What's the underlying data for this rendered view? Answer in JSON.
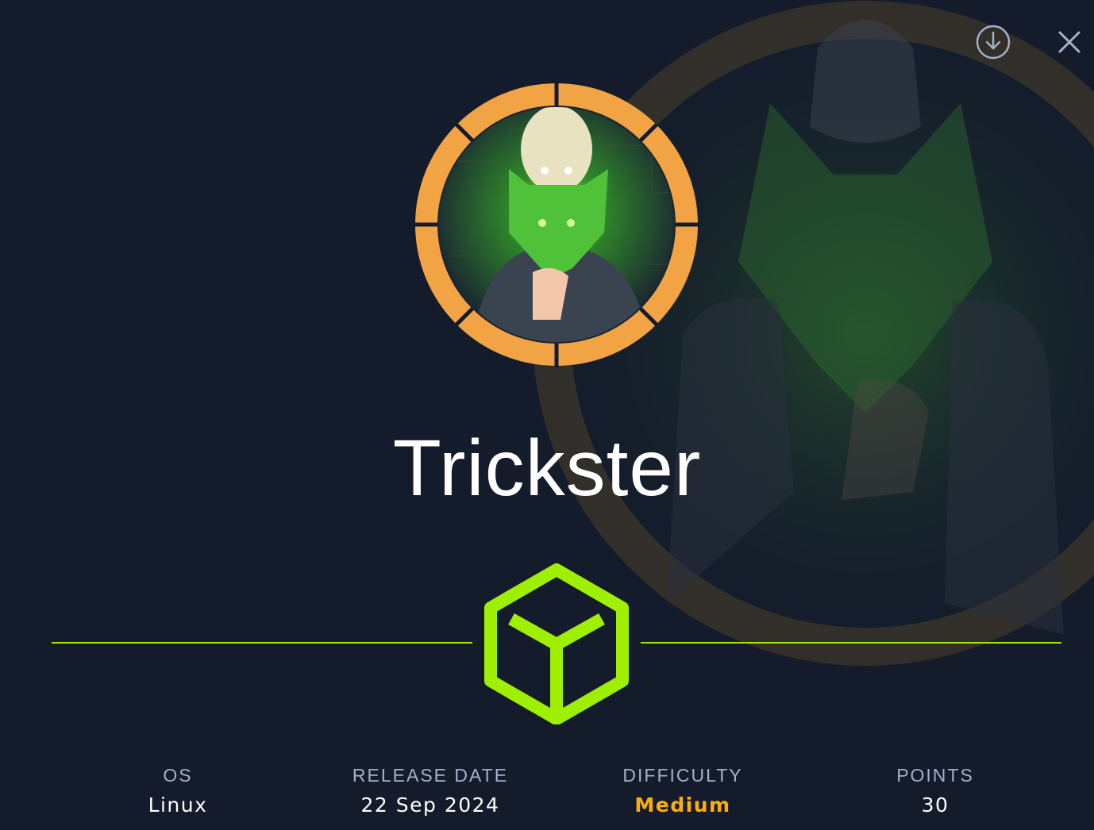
{
  "machine": {
    "name": "Trickster"
  },
  "stats": {
    "os": {
      "label": "OS",
      "value": "Linux"
    },
    "release_date": {
      "label": "RELEASE DATE",
      "value": "22 Sep 2024"
    },
    "difficulty": {
      "label": "DIFFICULTY",
      "value": "Medium"
    },
    "points": {
      "label": "POINTS",
      "value": "30"
    }
  },
  "controls": {
    "download_icon": "download-circle-icon",
    "close_icon": "close-icon"
  },
  "colors": {
    "background": "#141c2b",
    "accent_green": "#9fef00",
    "ring_orange": "#f2a444",
    "difficulty_medium": "#ffaf00",
    "label_gray": "#a4b1cd"
  }
}
